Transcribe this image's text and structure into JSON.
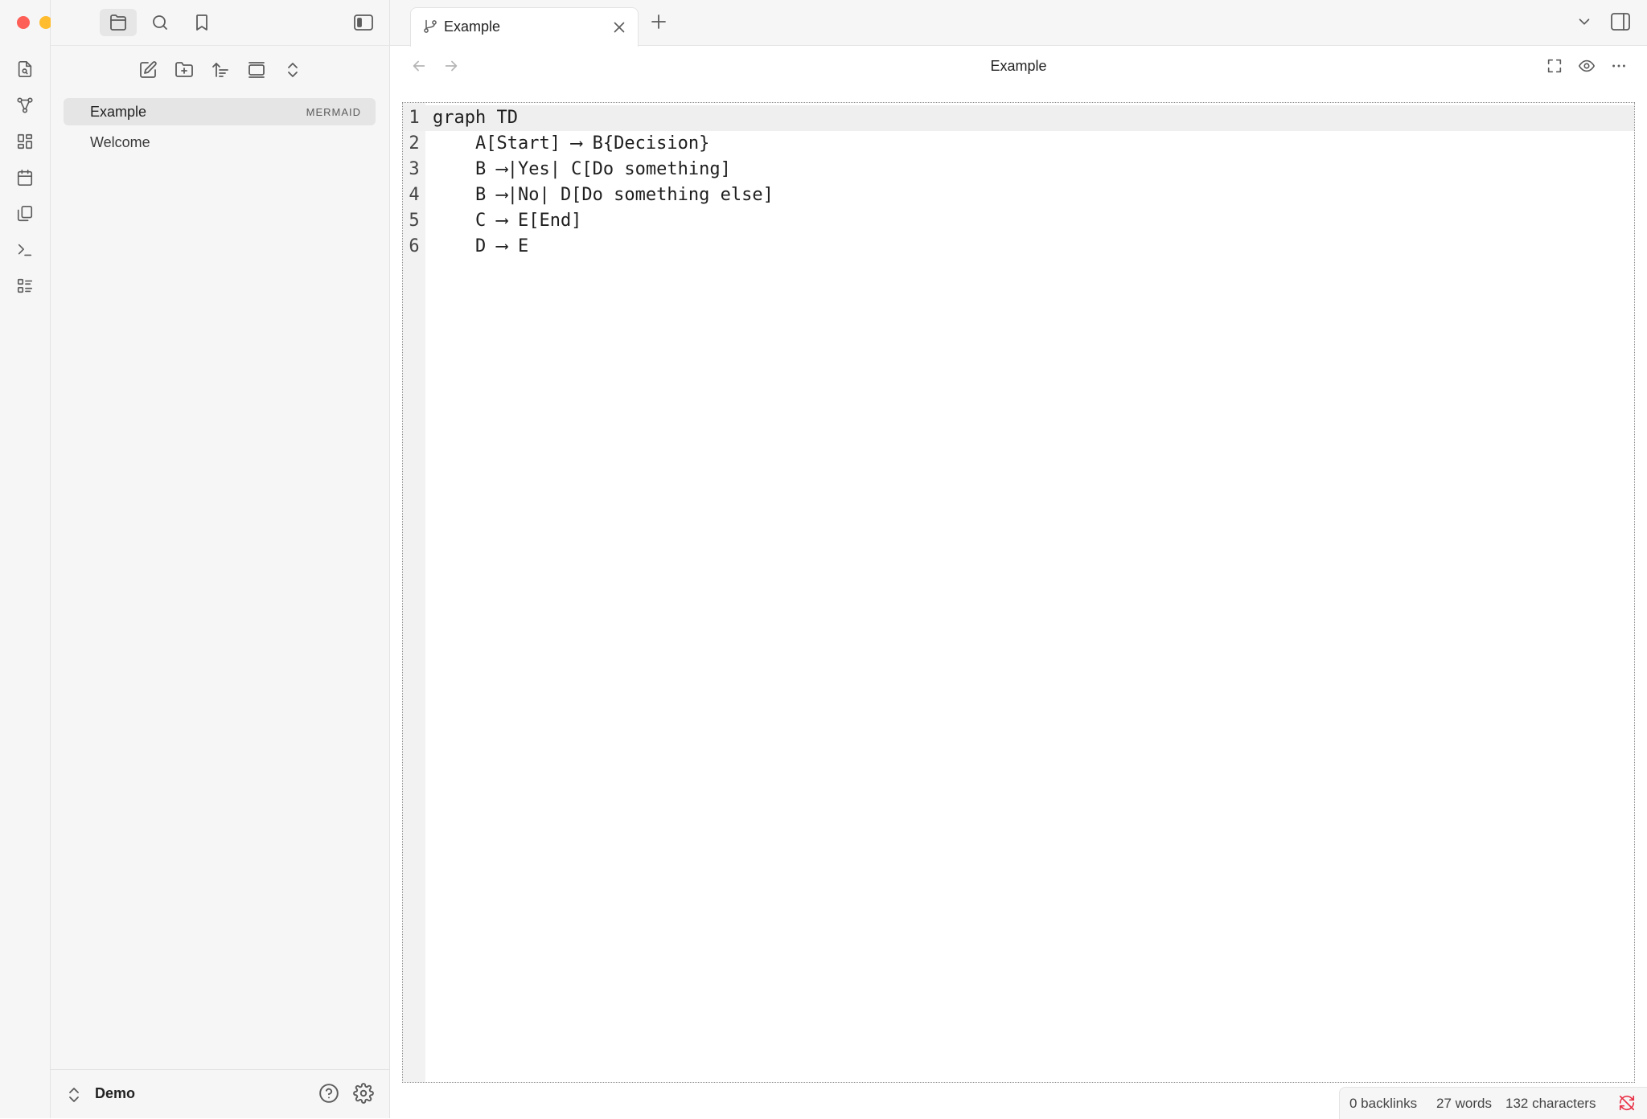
{
  "window": {
    "traffic_lights": {
      "close_color": "#fe5f57",
      "minimize_color": "#febc2e",
      "zoom_color": "#28c840"
    }
  },
  "ribbon": {
    "icons": [
      "open-quick-switcher-icon",
      "graph-view-icon",
      "canvas-icon",
      "daily-note-icon",
      "templates-icon",
      "command-palette-icon",
      "outline-icon"
    ]
  },
  "sidebar": {
    "top_tabs": [
      "files-icon",
      "search-icon",
      "bookmarks-icon"
    ],
    "nav_actions": [
      "new-note-icon",
      "new-folder-icon",
      "sort-icon",
      "auto-reveal-icon",
      "collapse-all-icon"
    ],
    "files": [
      {
        "label": "Example",
        "badge": "MERMAID",
        "active": true
      },
      {
        "label": "Welcome",
        "badge": "",
        "active": false
      }
    ],
    "vault": {
      "name": "Demo"
    }
  },
  "tabs": [
    {
      "title": "Example"
    }
  ],
  "view": {
    "title": "Example"
  },
  "editor": {
    "current_line": 1,
    "lines": [
      {
        "num": "1",
        "text": "graph TD"
      },
      {
        "num": "2",
        "text": "    A[Start] ⟶ B{Decision}"
      },
      {
        "num": "3",
        "text": "    B ⟶|Yes| C[Do something]"
      },
      {
        "num": "4",
        "text": "    B ⟶|No| D[Do something else]"
      },
      {
        "num": "5",
        "text": "    C ⟶ E[End]"
      },
      {
        "num": "6",
        "text": "    D ⟶ E"
      }
    ]
  },
  "status": {
    "backlinks": "0 backlinks",
    "words": "27 words",
    "characters": "132 characters",
    "sync_status_color": "#e93147"
  }
}
